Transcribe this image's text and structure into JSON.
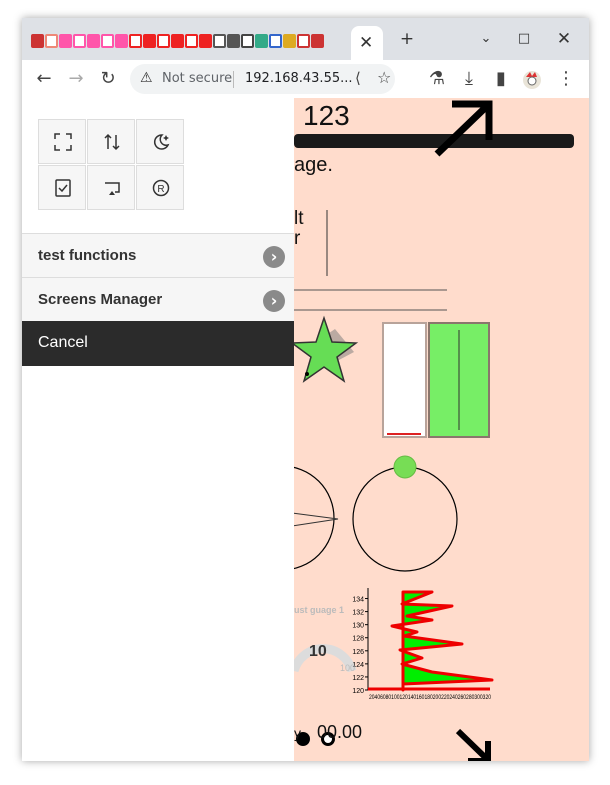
{
  "browser": {
    "address": {
      "security_label": "Not secure",
      "url": "192.168.43.55..."
    },
    "favicons": [
      "#c33",
      "#e87",
      "#f5a",
      "#f5a",
      "#f5a",
      "#f5a",
      "#f5a",
      "#e22",
      "#e22",
      "#e22",
      "#e22",
      "#e22",
      "#e22",
      "#555",
      "#555",
      "#444",
      "#3a8",
      "#36c",
      "#da2",
      "#c33",
      "#c33"
    ]
  },
  "drawer": {
    "tools": [
      "fullscreen-icon",
      "swap-vertical-icon",
      "night-mode-icon",
      "checklist-icon",
      "cast-icon",
      "registered-icon"
    ],
    "menu": [
      {
        "label": "test functions"
      },
      {
        "label": "Screens Manager"
      }
    ],
    "cancel_label": "Cancel"
  },
  "page": {
    "heading_number": "123",
    "fragment_age": "age.",
    "fragment_lt": "lt",
    "fragment_r": "r",
    "gauge_title": "ust guage 1",
    "gauge_value": "10",
    "gauge_max": "100",
    "fragment_y": "y",
    "number_display": "00.00"
  },
  "chart_data": {
    "type": "area",
    "orientation": "horizontal",
    "y_ticks": [
      120,
      122,
      124,
      126,
      128,
      130,
      132,
      134
    ],
    "x_tick_text": "20406080100120140160180200220240260280300320",
    "ylim": [
      120,
      135
    ],
    "xlim": [
      0,
      320
    ],
    "series": [
      {
        "x": [
          80,
          310
        ],
        "y": [
          121,
          121.5
        ],
        "fill": "#00ee00",
        "stroke": "#ee0000"
      }
    ]
  },
  "colors": {
    "page_bg": "#ffdccc",
    "green": "#66dd55",
    "chart_red": "#ee0000",
    "chart_green": "#00ee00"
  }
}
